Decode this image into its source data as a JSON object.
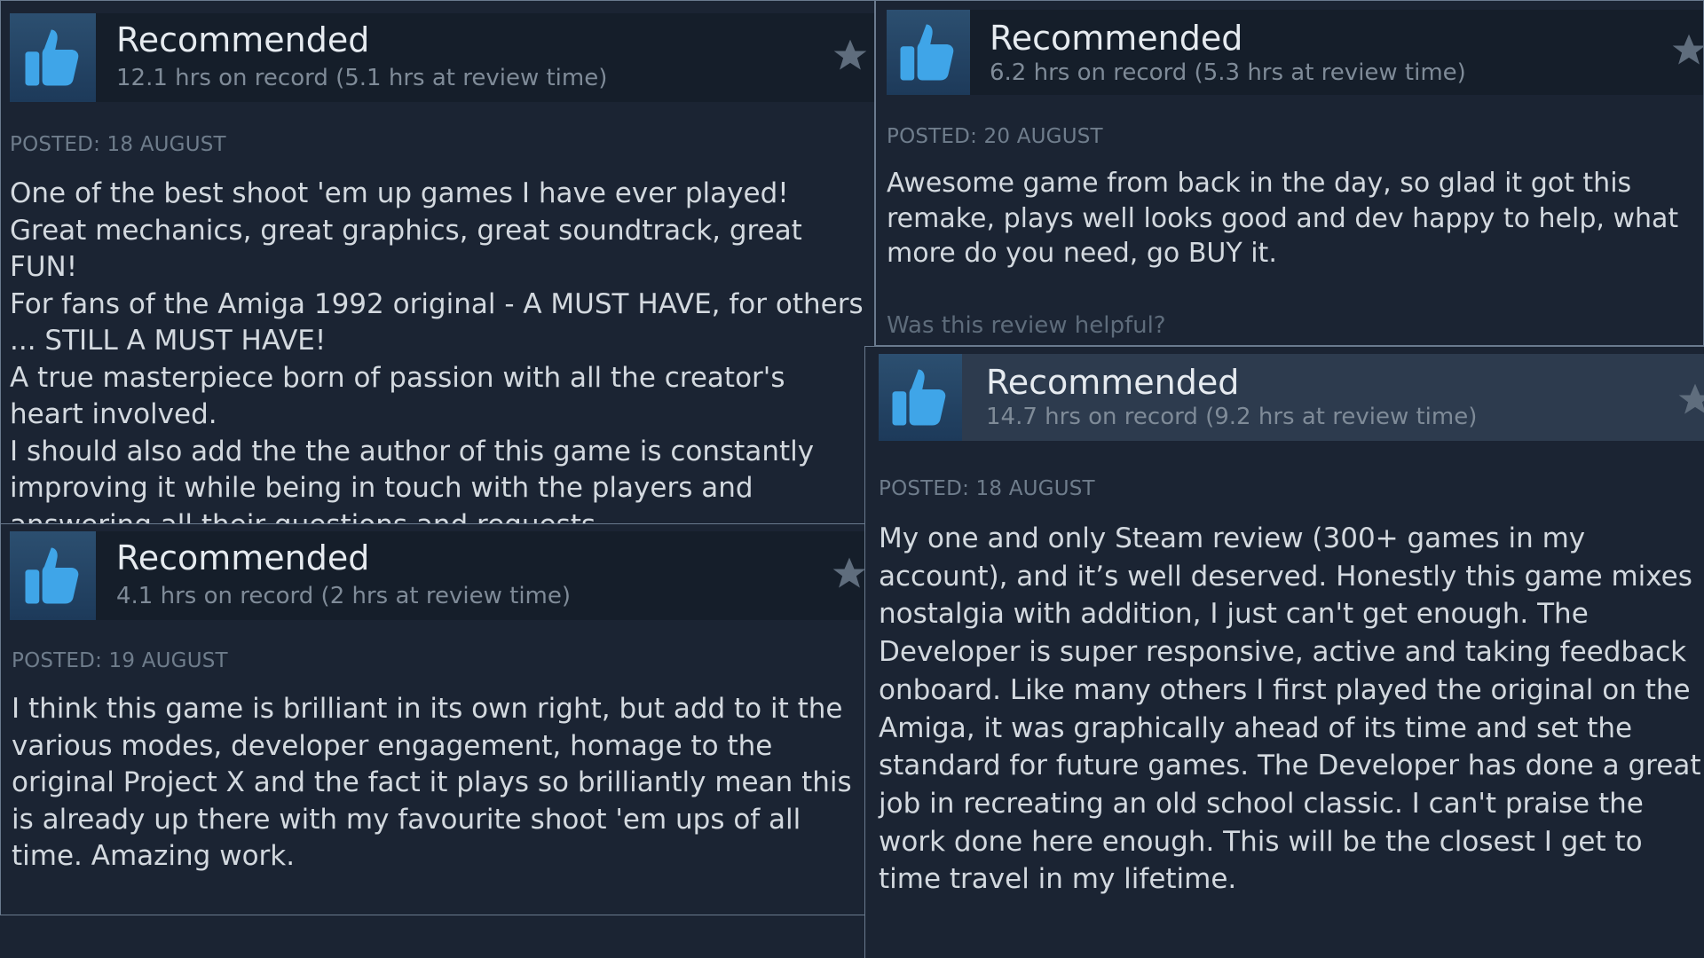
{
  "colors": {
    "page_background": "#1b2433",
    "header_background": "#151e2a",
    "header_background_light": "#2d3b4e",
    "thumb_blue": "#3fa5e8",
    "title_text": "#e6ebf0",
    "meta_text": "#7f8b98",
    "body_text": "#d3d9df"
  },
  "reviews": [
    {
      "verdict": "Recommended",
      "thumb_icon": "thumbs-up-icon",
      "award_icon": "star-icon",
      "hours": "12.1 hrs on record (5.1 hrs at review time)",
      "posted": "POSTED: 18 AUGUST",
      "paragraphs": [
        "One of the best shoot 'em up games I have ever played! Great mechanics, great graphics, great soundtrack, great FUN!",
        "For fans of the Amiga 1992 original - A MUST HAVE, for others ... STILL A MUST HAVE!",
        "A true masterpiece born of passion with all the creator's heart involved.",
        "I should also add the the author of this game is constantly improving it while being in touch with the players and answering all their questions and requests."
      ]
    },
    {
      "verdict": "Recommended",
      "thumb_icon": "thumbs-up-icon",
      "award_icon": "star-icon",
      "hours": "6.2 hrs on record (5.3 hrs at review time)",
      "posted": "POSTED: 20 AUGUST",
      "paragraphs": [
        "Awesome game from back in the day, so glad it got this remake, plays well looks good and dev happy to help, what more do you need, go BUY it."
      ],
      "helpful_prompt": "Was this review helpful?"
    },
    {
      "verdict": "Recommended",
      "thumb_icon": "thumbs-up-icon",
      "award_icon": "star-icon",
      "hours": "4.1 hrs on record (2 hrs at review time)",
      "posted": "POSTED: 19 AUGUST",
      "paragraphs": [
        "I think this game is brilliant in its own right, but add to it the various modes, developer engagement, homage to the original Project X and the fact it plays so brilliantly mean this is already up there with my favourite shoot 'em ups of all time. Amazing work."
      ]
    },
    {
      "verdict": "Recommended",
      "thumb_icon": "thumbs-up-icon",
      "award_icon": "star-icon",
      "hours": "14.7 hrs on record (9.2 hrs at review time)",
      "posted": "POSTED: 18 AUGUST",
      "paragraphs": [
        "My one and only Steam review (300+ games in my account), and it’s well deserved. Honestly this game mixes nostalgia with addition, I just can't get enough. The Developer is super responsive, active and taking feedback onboard. Like many others I first played the original on the Amiga, it was graphically ahead of its time and set the standard for future games. The Developer has done a great job in recreating an old school classic. I can't praise the work done here enough. This will be the closest I get to time travel in my lifetime."
      ]
    }
  ]
}
